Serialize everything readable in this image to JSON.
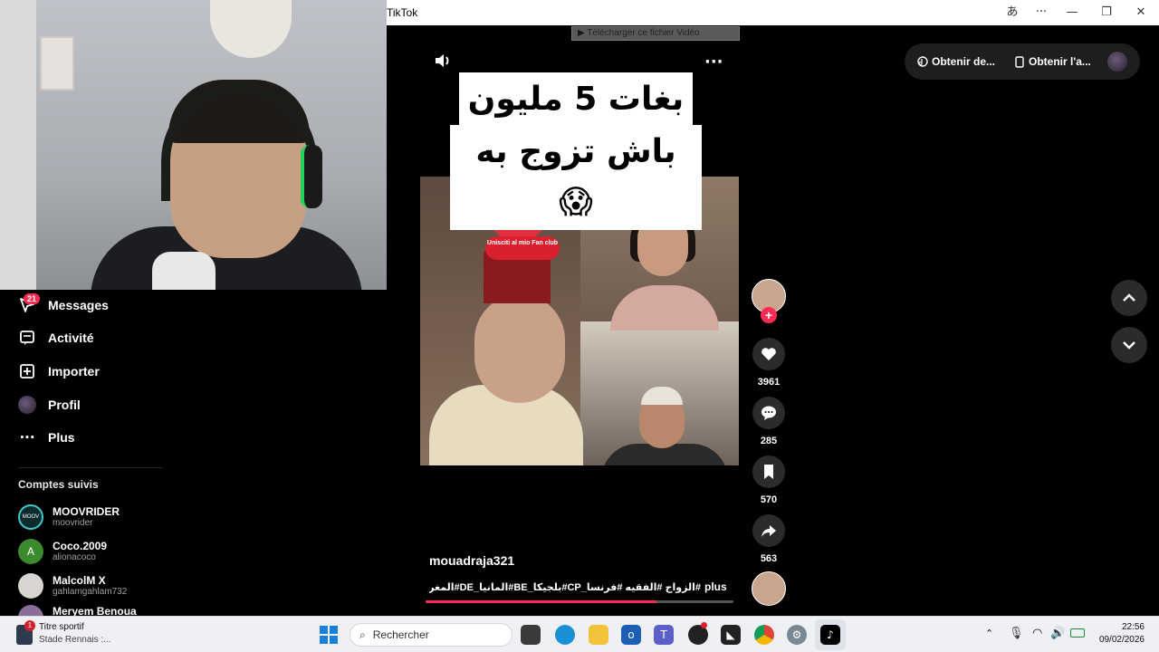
{
  "window": {
    "title": "TikTok",
    "translate_icon": "translate-icon",
    "more_icon": "more-icon",
    "minimize_icon": "minimize-icon",
    "maximize_icon": "maximize-icon",
    "close_icon": "close-icon"
  },
  "download_bar": {
    "label": "Télécharger ce fichier Vidéo"
  },
  "sidebar": {
    "messages_badge": "21",
    "items": [
      {
        "label": "Messages",
        "icon": "send-icon"
      },
      {
        "label": "Activité",
        "icon": "activity-icon"
      },
      {
        "label": "Importer",
        "icon": "upload-icon"
      },
      {
        "label": "Profil",
        "icon": "avatar"
      },
      {
        "label": "Plus",
        "icon": "ellipsis-icon"
      }
    ],
    "following_title": "Comptes suivis",
    "following": [
      {
        "name": "MOOVRIDER",
        "handle": "moovrider"
      },
      {
        "name": "Coco.2009",
        "handle": "alionacoco",
        "initial": "A"
      },
      {
        "name": "MalcolM X",
        "handle": "gahlamgahlam732"
      },
      {
        "name": "Meryem Benoua",
        "handle": ""
      }
    ]
  },
  "video": {
    "headline_line1": "بغات 5 مليون",
    "headline_line2": "باش تزوج به 😱",
    "overlay_label": "Unisciti al mio Fan club",
    "author": "mouadraja321",
    "caption": "#الزواج #الفقيه #فرنسا_CP#بلجيكا_BE#المانيا_DE#المغرب_MA#تونس...",
    "more_label": "plus",
    "progress": 0.75
  },
  "actions": {
    "likes": "3961",
    "comments": "285",
    "saves": "570",
    "shares": "563"
  },
  "top_right": {
    "get_app_label": "Obtenir de...",
    "get_desktop_label": "Obtenir l'a..."
  },
  "taskbar": {
    "notification_badge": "1",
    "widget_title": "Titre sportif",
    "widget_subtitle": "Stade Rennais :...",
    "search_placeholder": "Rechercher",
    "time": "22:56",
    "date": "09/02/2026"
  },
  "colors": {
    "accent": "#fe2c55",
    "background": "#000000",
    "taskbar": "#eef0f4"
  }
}
